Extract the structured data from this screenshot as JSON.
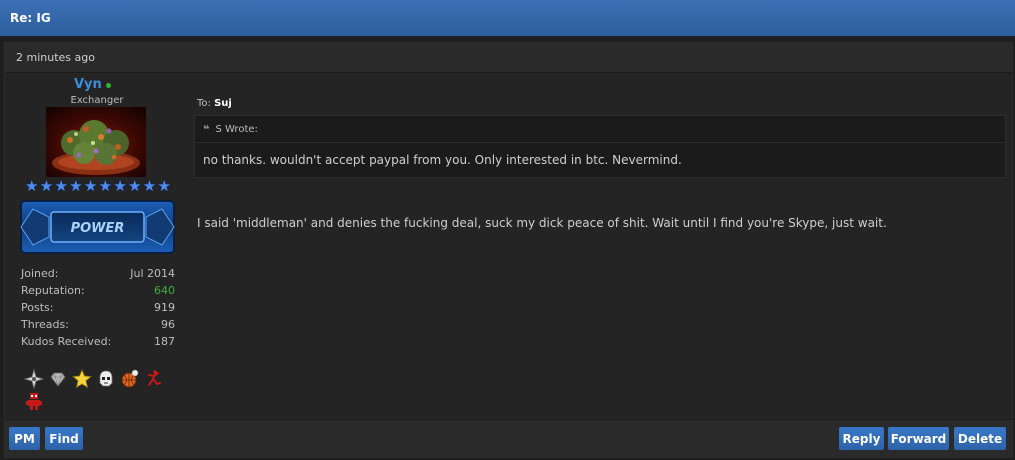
{
  "thread": {
    "title": "Re: IG"
  },
  "post": {
    "time": "2 minutes ago",
    "author": {
      "username": "Vyn",
      "user_title": "Exchanger",
      "star_count": 10,
      "rank_badge_text": "POWER",
      "stats": [
        {
          "label": "Joined:",
          "value": "Jul 2014",
          "color": "#bdbdbd"
        },
        {
          "label": "Reputation:",
          "value": "640",
          "color": "#3eac3e"
        },
        {
          "label": "Posts:",
          "value": "919",
          "color": "#bdbdbd"
        },
        {
          "label": "Threads:",
          "value": "96",
          "color": "#bdbdbd"
        },
        {
          "label": "Kudos Received:",
          "value": "187",
          "color": "#bdbdbd"
        }
      ],
      "awards": [
        "shuriken-icon",
        "diamond-icon",
        "gold-star-icon",
        "stormtrooper-icon",
        "basketball-icon",
        "jumpman-icon",
        "red-robot-icon"
      ]
    },
    "to_label": "To:",
    "to_user": "Suj",
    "quote": {
      "mark": "❝",
      "header": "S Wrote:",
      "text": "no thanks. wouldn't accept paypal from you. Only interested in btc. Nevermind."
    },
    "message": "I said 'middleman' and denies the fucking deal, suck my dick peace of shit. Wait until I find you're Skype, just wait.",
    "buttons": {
      "pm": "PM",
      "find": "Find",
      "reply": "Reply",
      "forward": "Forward",
      "delete": "Delete"
    }
  },
  "colors": {
    "header_blue": "#3a70b3",
    "button_blue": "#3878c8",
    "username_blue": "#3c8ddc",
    "online_green": "#2fb82f",
    "reputation_green": "#3eac3e"
  }
}
